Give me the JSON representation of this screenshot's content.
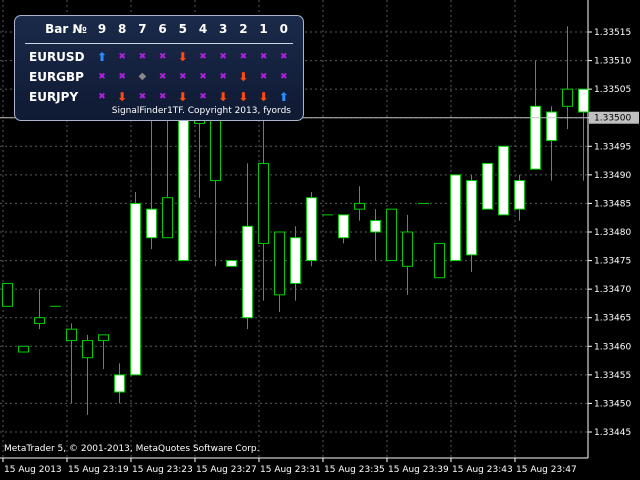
{
  "chart_data": {
    "type": "candlestick",
    "y_ticks": [
      "1.33515",
      "1.33510",
      "1.33505",
      "1.33500",
      "1.33495",
      "1.33490",
      "1.33485",
      "1.33480",
      "1.33475",
      "1.33470",
      "1.33465",
      "1.33460",
      "1.33455",
      "1.33450",
      "1.33445"
    ],
    "x_ticks": [
      "15 Aug 2013",
      "15 Aug 23:19",
      "15 Aug 23:23",
      "15 Aug 23:27",
      "15 Aug 23:31",
      "15 Aug 23:35",
      "15 Aug 23:39",
      "15 Aug 23:43",
      "15 Aug 23:47"
    ],
    "current_price": "1.33500",
    "ylim": [
      1.3344,
      1.3352
    ],
    "grid": true,
    "candles": [
      {
        "o": 1.33471,
        "h": 1.33471,
        "l": 1.33467,
        "c": 1.33467
      },
      {
        "o": 1.3346,
        "h": 1.3346,
        "l": 1.33459,
        "c": 1.33459
      },
      {
        "o": 1.33465,
        "h": 1.3347,
        "l": 1.33463,
        "c": 1.33464
      },
      {
        "o": 1.33467,
        "h": 1.33467,
        "l": 1.33467,
        "c": 1.33467
      },
      {
        "o": 1.33463,
        "h": 1.33464,
        "l": 1.3345,
        "c": 1.33461
      },
      {
        "o": 1.33461,
        "h": 1.33462,
        "l": 1.33448,
        "c": 1.33458
      },
      {
        "o": 1.33462,
        "h": 1.33462,
        "l": 1.33456,
        "c": 1.33461
      },
      {
        "o": 1.33452,
        "h": 1.33457,
        "l": 1.3345,
        "c": 1.33455
      },
      {
        "o": 1.33455,
        "h": 1.33487,
        "l": 1.33455,
        "c": 1.33485
      },
      {
        "o": 1.33479,
        "h": 1.33505,
        "l": 1.33477,
        "c": 1.33484
      },
      {
        "o": 1.33486,
        "h": 1.33506,
        "l": 1.33479,
        "c": 1.33479
      },
      {
        "o": 1.33475,
        "h": 1.33505,
        "l": 1.33475,
        "c": 1.335
      },
      {
        "o": 1.335,
        "h": 1.33502,
        "l": 1.33486,
        "c": 1.33499
      },
      {
        "o": 1.335,
        "h": 1.33502,
        "l": 1.33474,
        "c": 1.33489
      },
      {
        "o": 1.33474,
        "h": 1.33475,
        "l": 1.33474,
        "c": 1.33475
      },
      {
        "o": 1.33465,
        "h": 1.33492,
        "l": 1.33463,
        "c": 1.33481
      },
      {
        "o": 1.33492,
        "h": 1.33502,
        "l": 1.33468,
        "c": 1.33478
      },
      {
        "o": 1.3348,
        "h": 1.3348,
        "l": 1.33466,
        "c": 1.33469
      },
      {
        "o": 1.33471,
        "h": 1.33481,
        "l": 1.33468,
        "c": 1.33479
      },
      {
        "o": 1.33475,
        "h": 1.33487,
        "l": 1.33474,
        "c": 1.33486
      },
      {
        "o": 1.33483,
        "h": 1.33483,
        "l": 1.33483,
        "c": 1.33483
      },
      {
        "o": 1.33479,
        "h": 1.33483,
        "l": 1.33478,
        "c": 1.33483
      },
      {
        "o": 1.33485,
        "h": 1.33488,
        "l": 1.33482,
        "c": 1.33484
      },
      {
        "o": 1.3348,
        "h": 1.33484,
        "l": 1.33475,
        "c": 1.33482
      },
      {
        "o": 1.33484,
        "h": 1.33484,
        "l": 1.33476,
        "c": 1.33475
      },
      {
        "o": 1.3348,
        "h": 1.33483,
        "l": 1.33469,
        "c": 1.33474
      },
      {
        "o": 1.33485,
        "h": 1.33485,
        "l": 1.33485,
        "c": 1.33485
      },
      {
        "o": 1.33478,
        "h": 1.33478,
        "l": 1.33472,
        "c": 1.33472
      },
      {
        "o": 1.33475,
        "h": 1.3349,
        "l": 1.33475,
        "c": 1.3349
      },
      {
        "o": 1.33476,
        "h": 1.3349,
        "l": 1.33473,
        "c": 1.33489
      },
      {
        "o": 1.33484,
        "h": 1.33492,
        "l": 1.33484,
        "c": 1.33492
      },
      {
        "o": 1.33483,
        "h": 1.33495,
        "l": 1.33483,
        "c": 1.33495
      },
      {
        "o": 1.33484,
        "h": 1.3349,
        "l": 1.33482,
        "c": 1.33489
      },
      {
        "o": 1.33491,
        "h": 1.3351,
        "l": 1.33491,
        "c": 1.33502
      },
      {
        "o": 1.33496,
        "h": 1.33502,
        "l": 1.33489,
        "c": 1.33501
      },
      {
        "o": 1.33505,
        "h": 1.33516,
        "l": 1.33498,
        "c": 1.33502
      },
      {
        "o": 1.33501,
        "h": 1.33505,
        "l": 1.33489,
        "c": 1.33505
      }
    ]
  },
  "copyright": "MetaTrader 5, © 2001-2013, MetaQuotes Software Corp.",
  "panel": {
    "header_label": "Bar №",
    "bars": [
      "9",
      "8",
      "7",
      "6",
      "5",
      "4",
      "3",
      "2",
      "1",
      "0"
    ],
    "rows": [
      {
        "symbol": "EURUSD",
        "signals": [
          "up",
          "x",
          "x",
          "x",
          "down",
          "x",
          "x",
          "x",
          "x",
          "x"
        ]
      },
      {
        "symbol": "EURGBP",
        "signals": [
          "x",
          "x",
          "dot",
          "x",
          "x",
          "x",
          "x",
          "down",
          "x",
          "x"
        ]
      },
      {
        "symbol": "EURJPY",
        "signals": [
          "x",
          "down",
          "x",
          "x",
          "down",
          "x",
          "down",
          "down",
          "down",
          "up"
        ]
      }
    ],
    "footer": "SignalFinder1TF. Copyright 2013, fyords"
  },
  "colors": {
    "background": "#000000",
    "grid": "#5a5a5a",
    "candle": "#00cc00",
    "body_fill": "#ffffff",
    "price_line": "#c0c0c0"
  }
}
